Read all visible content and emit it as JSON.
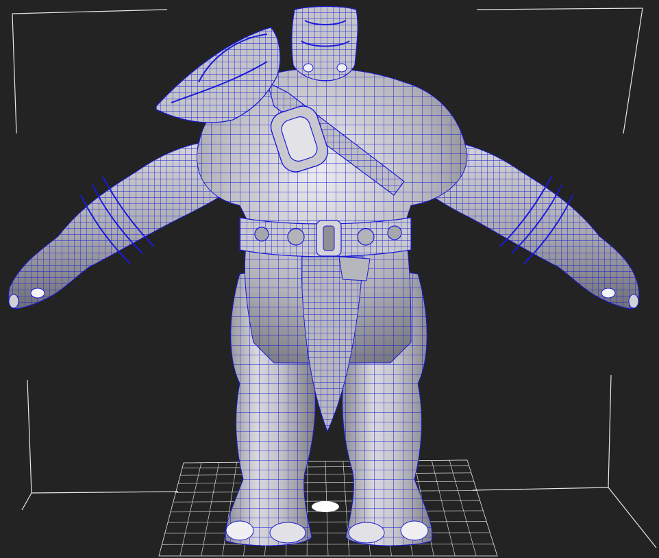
{
  "viewport": {
    "background_color": "#232323",
    "bounding_box_color": "#e8e8e8",
    "floor_grid_color": "#d8d8d8",
    "wireframe_color": "#1a1ad8",
    "mesh_shading_color": "#b9b9c0",
    "pivot_marker_color": "#ffffff",
    "model": {
      "name": "",
      "display_mode": "shaded-wireframe",
      "icon": "hippo-warrior-mesh"
    }
  }
}
